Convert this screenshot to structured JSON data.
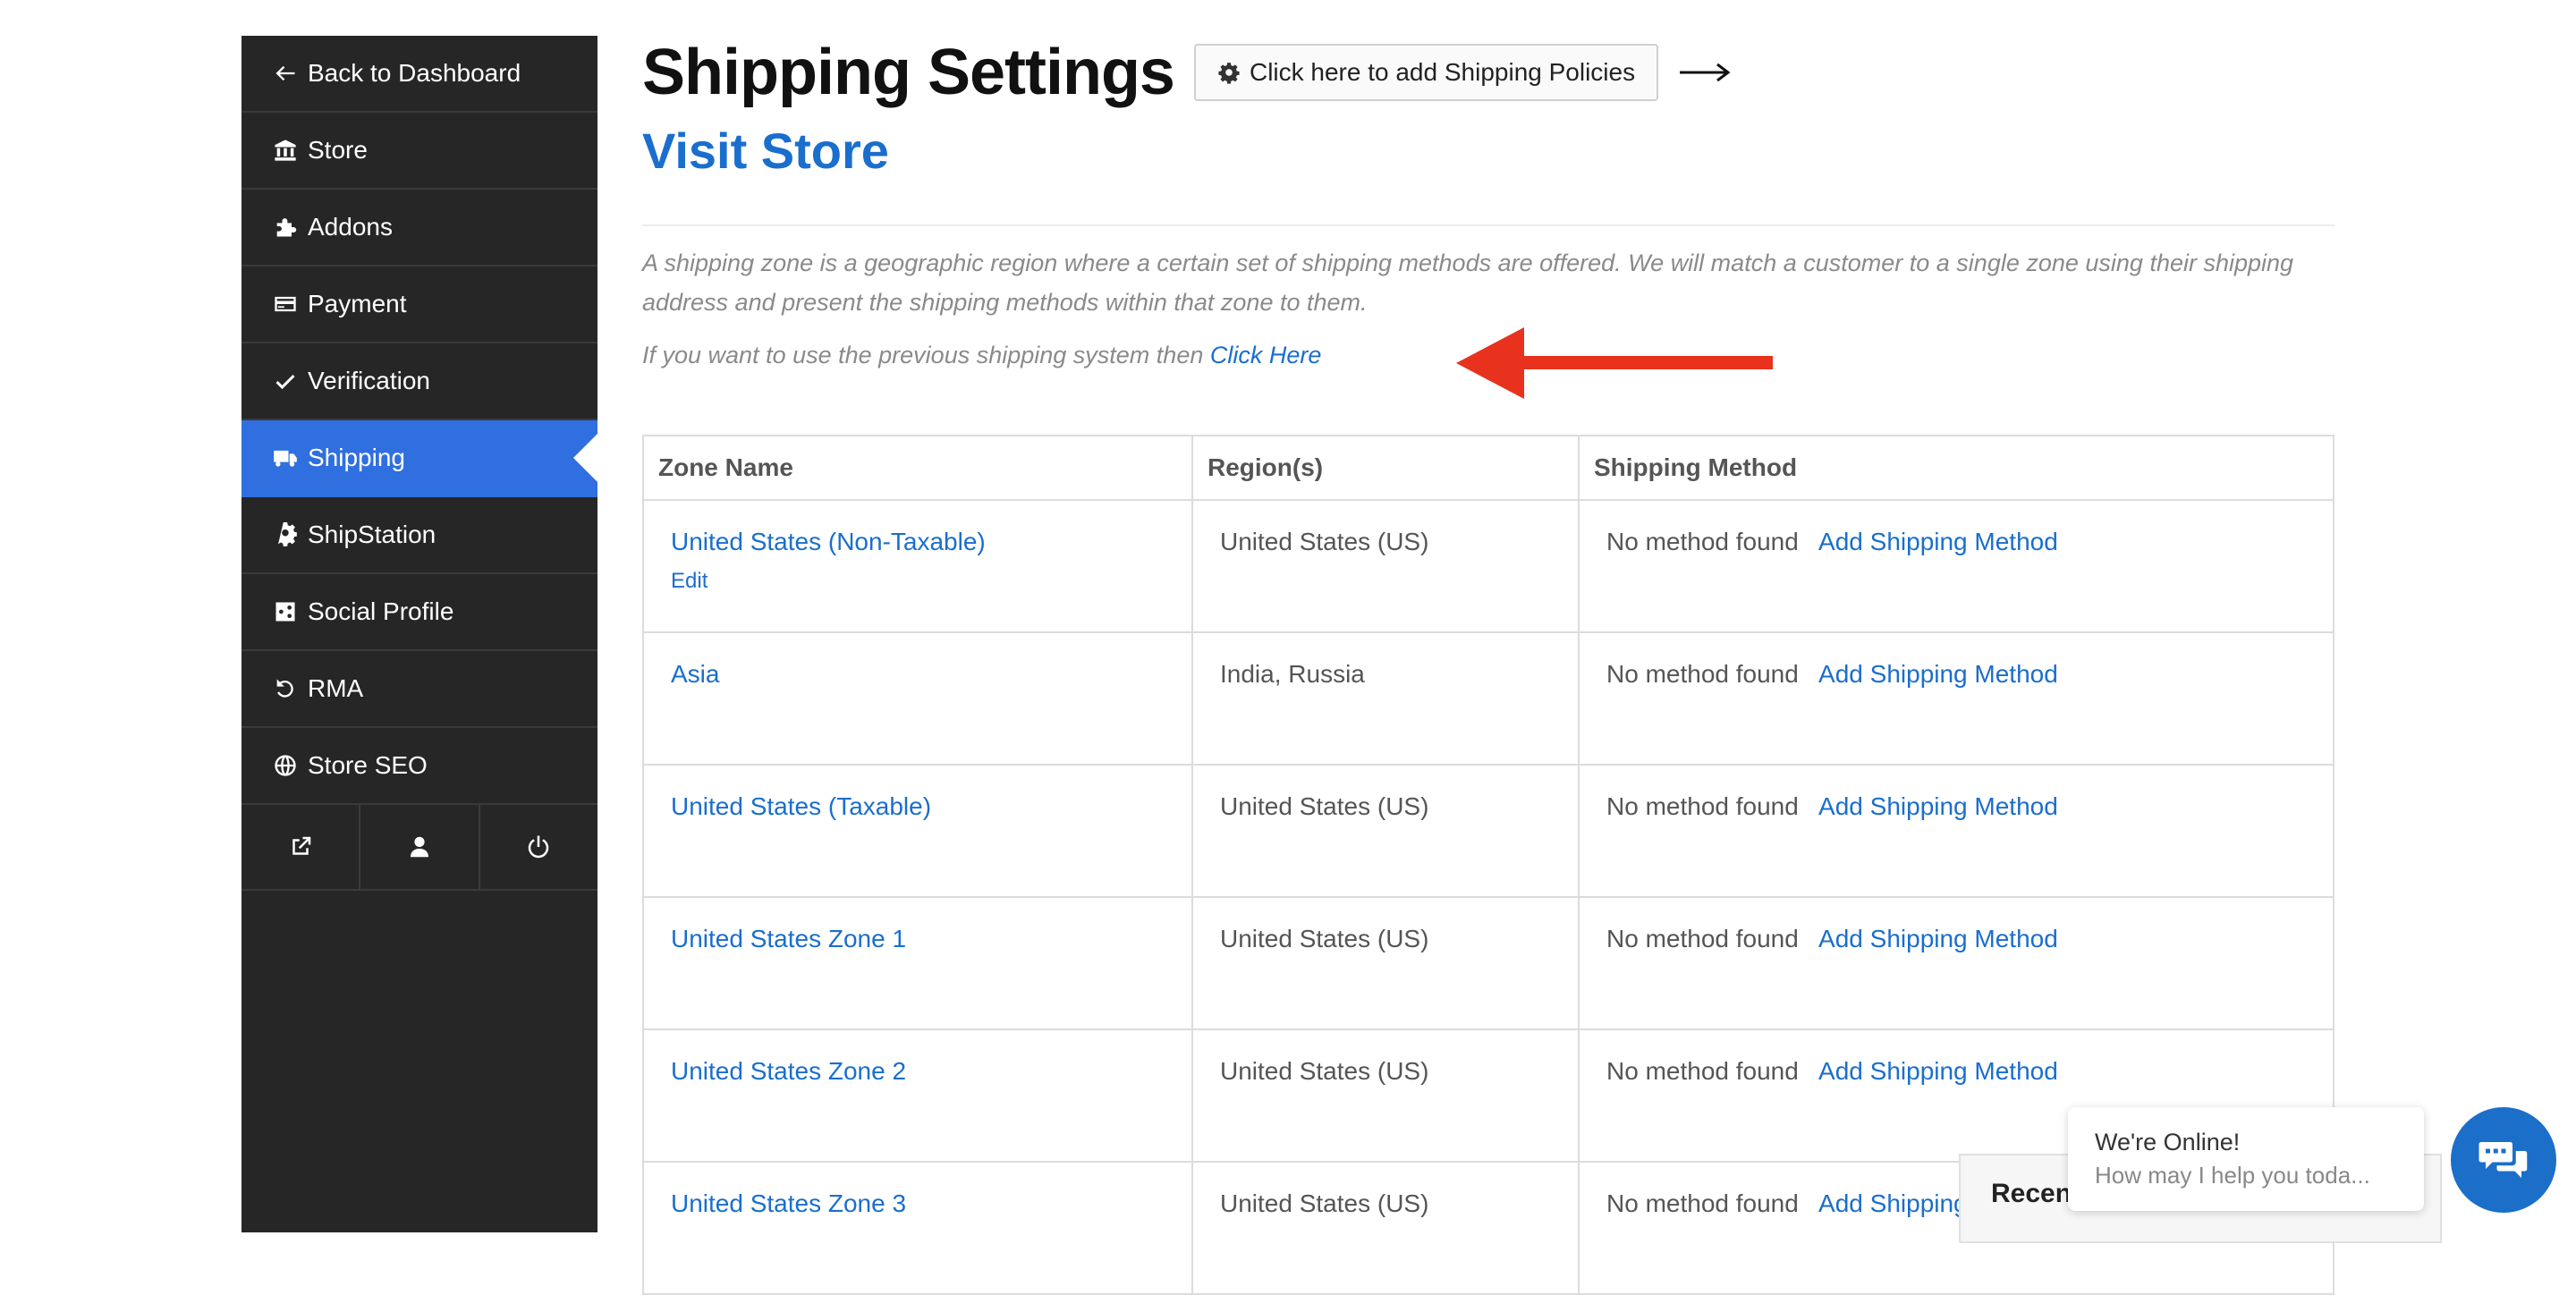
{
  "sidebar": {
    "items": [
      {
        "label": "Back to Dashboard",
        "icon": "arrow-left-icon"
      },
      {
        "label": "Store",
        "icon": "bank-icon"
      },
      {
        "label": "Addons",
        "icon": "puzzle-icon"
      },
      {
        "label": "Payment",
        "icon": "credit-card-icon"
      },
      {
        "label": "Verification",
        "icon": "check-icon"
      },
      {
        "label": "Shipping",
        "icon": "truck-icon",
        "active": true
      },
      {
        "label": "ShipStation",
        "icon": "gear-icon"
      },
      {
        "label": "Social Profile",
        "icon": "share-icon"
      },
      {
        "label": "RMA",
        "icon": "undo-icon"
      },
      {
        "label": "Store SEO",
        "icon": "globe-icon"
      }
    ],
    "bottom_icons": [
      "external-link-icon",
      "user-icon",
      "power-icon"
    ]
  },
  "header": {
    "title": "Shipping Settings",
    "policy_button": "Click here to add Shipping Policies",
    "visit_store": "Visit Store"
  },
  "description": "A shipping zone is a geographic region where a certain set of shipping methods are offered. We will match a customer to a single zone using their shipping address and present the shipping methods within that zone to them.",
  "previous_system": {
    "text": "If you want to use the previous shipping system then ",
    "link": "Click Here"
  },
  "table": {
    "headers": [
      "Zone Name",
      "Region(s)",
      "Shipping Method"
    ],
    "rows": [
      {
        "zone": "United States (Non-Taxable)",
        "edit": "Edit",
        "regions": "United States (US)",
        "method": "No method found",
        "add": "Add Shipping Method"
      },
      {
        "zone": "Asia",
        "regions": "India, Russia",
        "method": "No method found",
        "add": "Add Shipping Method"
      },
      {
        "zone": "United States (Taxable)",
        "regions": "United States (US)",
        "method": "No method found",
        "add": "Add Shipping Method"
      },
      {
        "zone": "United States Zone 1",
        "regions": "United States (US)",
        "method": "No method found",
        "add": "Add Shipping Method"
      },
      {
        "zone": "United States Zone 2",
        "regions": "United States (US)",
        "method": "No method found",
        "add": "Add Shipping Method"
      },
      {
        "zone": "United States Zone 3",
        "regions": "United States (US)",
        "method": "No method found",
        "add": "Add Shipping Method"
      }
    ]
  },
  "chat": {
    "recent_label": "Recent",
    "online": "We're Online!",
    "help": "How may I help you toda..."
  },
  "colors": {
    "sidebar_bg": "#262626",
    "active": "#2f6fe0",
    "link": "#1a6ecd",
    "annotation_arrow": "#e8321e"
  }
}
